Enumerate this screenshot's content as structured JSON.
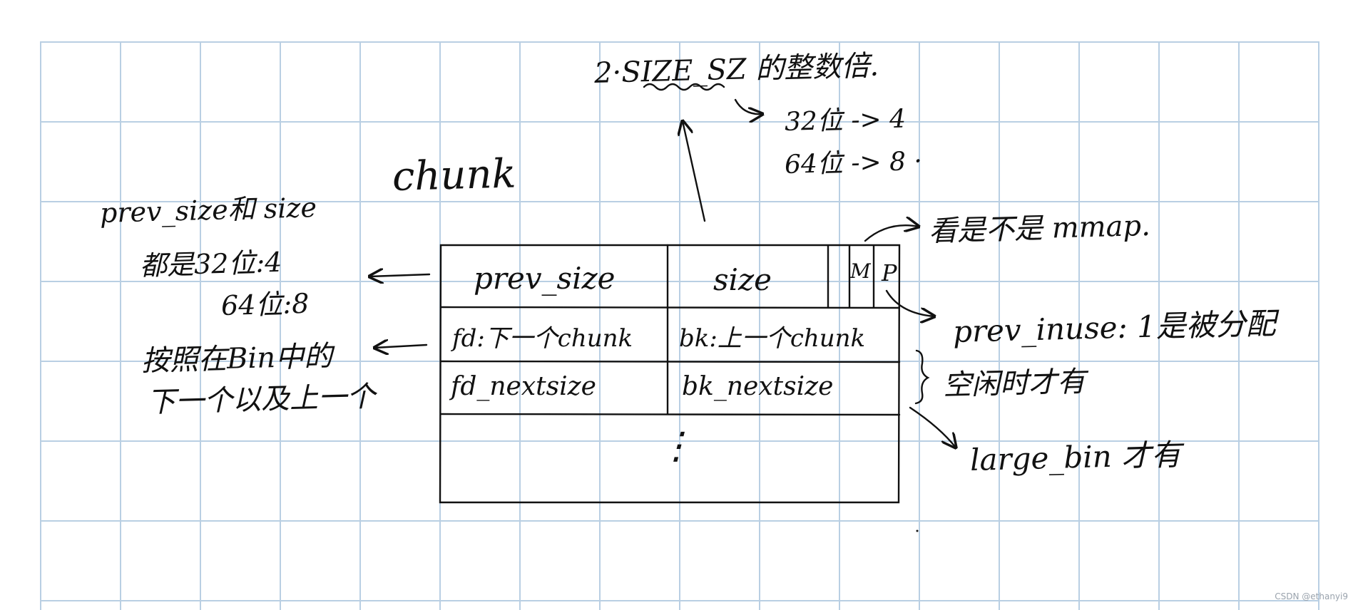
{
  "chunk_label": "chunk",
  "size_note": {
    "title": "2·SIZE_SZ 的整数倍.",
    "line_32": "32位 -> 4",
    "line_64": "64位 -> 8 ·"
  },
  "left_notes": {
    "prev_size_title": "prev_size和 size",
    "both_32": "都是32位:4",
    "both_64": "64位:8",
    "bin_line1": "按照在Bin中的",
    "bin_line2": "下一个以及上一个"
  },
  "right_notes": {
    "mmap": "看是不是 mmap.",
    "prev_inuse": "prev_inuse: 1是被分配",
    "free_only": "空闲时才有",
    "large_bin": "large_bin 才有"
  },
  "table": {
    "row1": {
      "prev_size": "prev_size",
      "size": "size",
      "flag_m": "M",
      "flag_p": "P"
    },
    "row2": {
      "fd": "fd:下一个chunk",
      "bk": "bk:上一个chunk"
    },
    "row3": {
      "fd_nextsize": "fd_nextsize",
      "bk_nextsize": "bk_nextsize"
    },
    "row4_ellipsis": "⋮"
  },
  "watermark": "CSDN @ethanyi9"
}
